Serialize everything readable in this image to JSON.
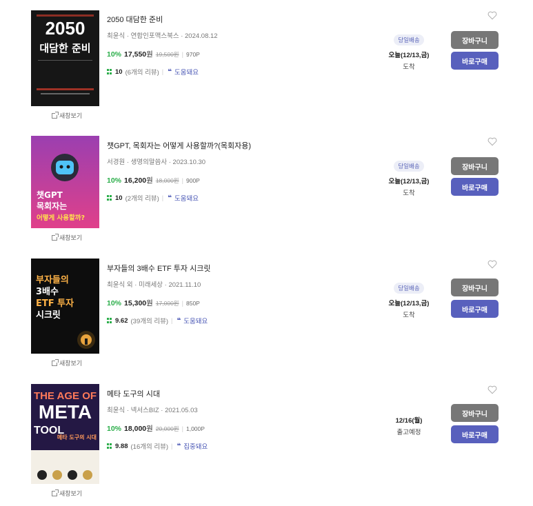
{
  "items": [
    {
      "title": "2050 대담한 준비",
      "meta": "최윤식 · 연합인포맥스북스 · 2024.08.12",
      "discount": "10%",
      "price": "17,550",
      "won": "원",
      "original_price": "19,500원",
      "points": "970P",
      "score": "10",
      "review_count": "(6개의 리뷰)",
      "review_tag": "도움돼요",
      "delivery_badge": "당일배송",
      "delivery_date": "오늘(12/13,금)",
      "delivery_status": "도착",
      "preview_label": "새창보기",
      "cart_label": "장바구니",
      "buy_label": "바로구매",
      "cover": {
        "small": "",
        "big1": "2050",
        "big2": "대담한 준비",
        "sub": "",
        "bg": "#151515"
      }
    },
    {
      "title": "챗GPT, 목회자는 어떻게 사용할까?(목회자용)",
      "meta": "서경원 · 생명의말씀사 · 2023.10.30",
      "discount": "10%",
      "price": "16,200",
      "won": "원",
      "original_price": "18,000원",
      "points": "900P",
      "score": "10",
      "review_count": "(2개의 리뷰)",
      "review_tag": "도움돼요",
      "delivery_badge": "당일배송",
      "delivery_date": "오늘(12/13,금)",
      "delivery_status": "도착",
      "preview_label": "새창보기",
      "cart_label": "장바구니",
      "buy_label": "바로구매",
      "cover": {
        "big1": "챗GPT",
        "big2": "목회자는",
        "big3": "어떻게 사용할까?"
      }
    },
    {
      "title": "부자들의 3배수 ETF 투자 시크릿",
      "meta": "최윤식 외 · 미래세상 · 2021.11.10",
      "discount": "10%",
      "price": "15,300",
      "won": "원",
      "original_price": "17,000원",
      "points": "850P",
      "score": "9.62",
      "review_count": "(39개의 리뷰)",
      "review_tag": "도움돼요",
      "delivery_badge": "당일배송",
      "delivery_date": "오늘(12/13,금)",
      "delivery_status": "도착",
      "preview_label": "새창보기",
      "cart_label": "장바구니",
      "buy_label": "바로구매",
      "cover": {
        "big1": "부자들의",
        "big2": "3배수",
        "big3": "ETF 투자",
        "big4": "시크릿"
      }
    },
    {
      "title": "메타 도구의 시대",
      "meta": "최윤식 · 넥서스BIZ · 2021.05.03",
      "discount": "10%",
      "price": "18,000",
      "won": "원",
      "original_price": "20,000원",
      "points": "1,000P",
      "score": "9.88",
      "review_count": "(16개의 리뷰)",
      "review_tag": "집중돼요",
      "delivery_badge": "",
      "delivery_date": "12/16(월)",
      "delivery_status": "출고예정",
      "preview_label": "새창보기",
      "cart_label": "장바구니",
      "buy_label": "바로구매",
      "cover": {
        "big1": "THE AGE OF",
        "big2": "META",
        "big3": "TOOL",
        "sub": "메타 도구의 시대"
      }
    }
  ],
  "colors": {
    "discount": "#2bae4a",
    "accent": "#5860bd",
    "cart_button": "#777777",
    "badge_bg": "#eceef7",
    "badge_text": "#5a64b8"
  }
}
